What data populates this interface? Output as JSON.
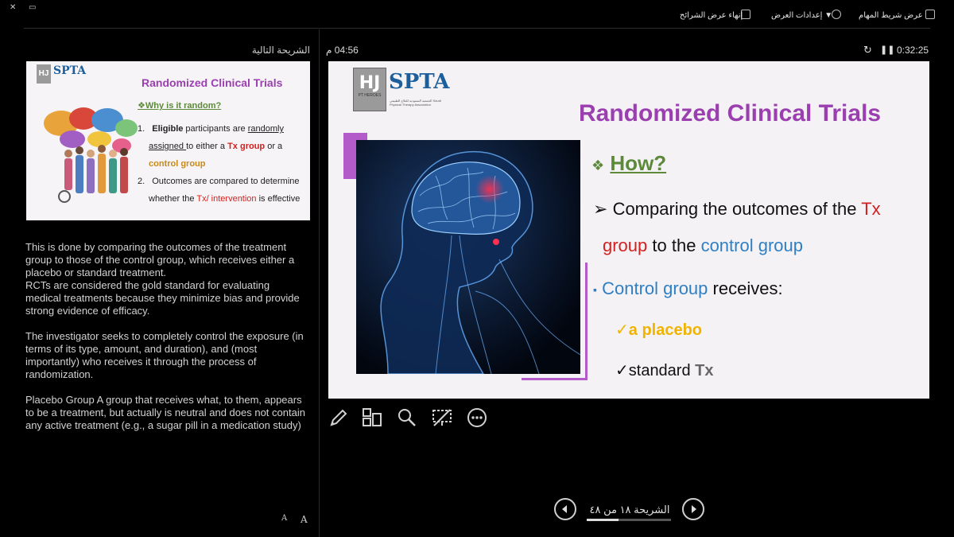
{
  "window_controls": {
    "close": "✕",
    "restore": "▭"
  },
  "topbar": {
    "show_taskbar": "عرض شريط المهام",
    "display_settings": "إعدادات العرض",
    "end_slideshow": "إنهاء عرض الشرائح",
    "dropdown_arrow": "▼"
  },
  "presenter": {
    "clock": "04:56 م",
    "timer": "0:32:25",
    "next_slide_label": "الشريحة التالية"
  },
  "next_slide": {
    "title": "Randomized Clinical Trials",
    "logo_hj": "HJ",
    "logo_spa": "SPTA",
    "question": "❖Why is it random?",
    "item1_num": "1.",
    "item1_a": "Eligible",
    "item1_b": " participants are ",
    "item1_c": "randomly",
    "item1_d": "assigned ",
    "item1_e": "to either a ",
    "item1_f": "Tx group",
    "item1_g": " or a",
    "item1_h": "control group",
    "item2_num": "2.",
    "item2_a": "Outcomes are compared to determine",
    "item2_b": "whether the ",
    "item2_c": "Tx/ intervention",
    "item2_d": " is effective"
  },
  "notes": {
    "p1": "This is done by comparing the outcomes of the treatment group to those of the control group, which receives either a placebo or standard treatment.\nRCTs are considered the gold standard for evaluating medical treatments because they minimize bias and provide strong evidence of efficacy.",
    "p2": "The investigator seeks to completely control the exposure (in terms of its type, amount, and duration), and (most importantly) who receives it through the process of randomization.",
    "p3": "Placebo Group A group that receives what, to them, appears to be a treatment, but actually is neutral and does not contain any active treatment (e.g., a sugar pill in a medication study)"
  },
  "current_slide": {
    "logo_hj": "HJ",
    "logo_hj_sub": "PT HEROES",
    "logo_spa": "SPTA",
    "logo_sub": "الجمعية السعودية للعلاج الطبيعي Saudi Physical Therapy Association",
    "title": "Randomized Clinical Trials",
    "how_bullet": "❖",
    "how": "How?",
    "l1_arrow": "➢",
    "l1_a": "Comparing the outcomes of the ",
    "l1_b": "Tx",
    "l2_a": "group",
    "l2_b": " to the ",
    "l2_c": "control group",
    "l3_bullet": "▪",
    "l3_a": "Control group",
    "l3_b": " receives:",
    "l4": "✓a placebo",
    "l5_a": "✓standard ",
    "l5_b": "Tx"
  },
  "font_buttons": {
    "decrease": "A",
    "increase": "A"
  },
  "navigation": {
    "slide_counter": "الشريحة ١٨ من ٤٨",
    "progress": 0.375
  },
  "icons": [
    "pen-icon",
    "slides-grid-icon",
    "zoom-icon",
    "screen-off-icon",
    "more-icon",
    "prev-icon",
    "next-icon"
  ]
}
